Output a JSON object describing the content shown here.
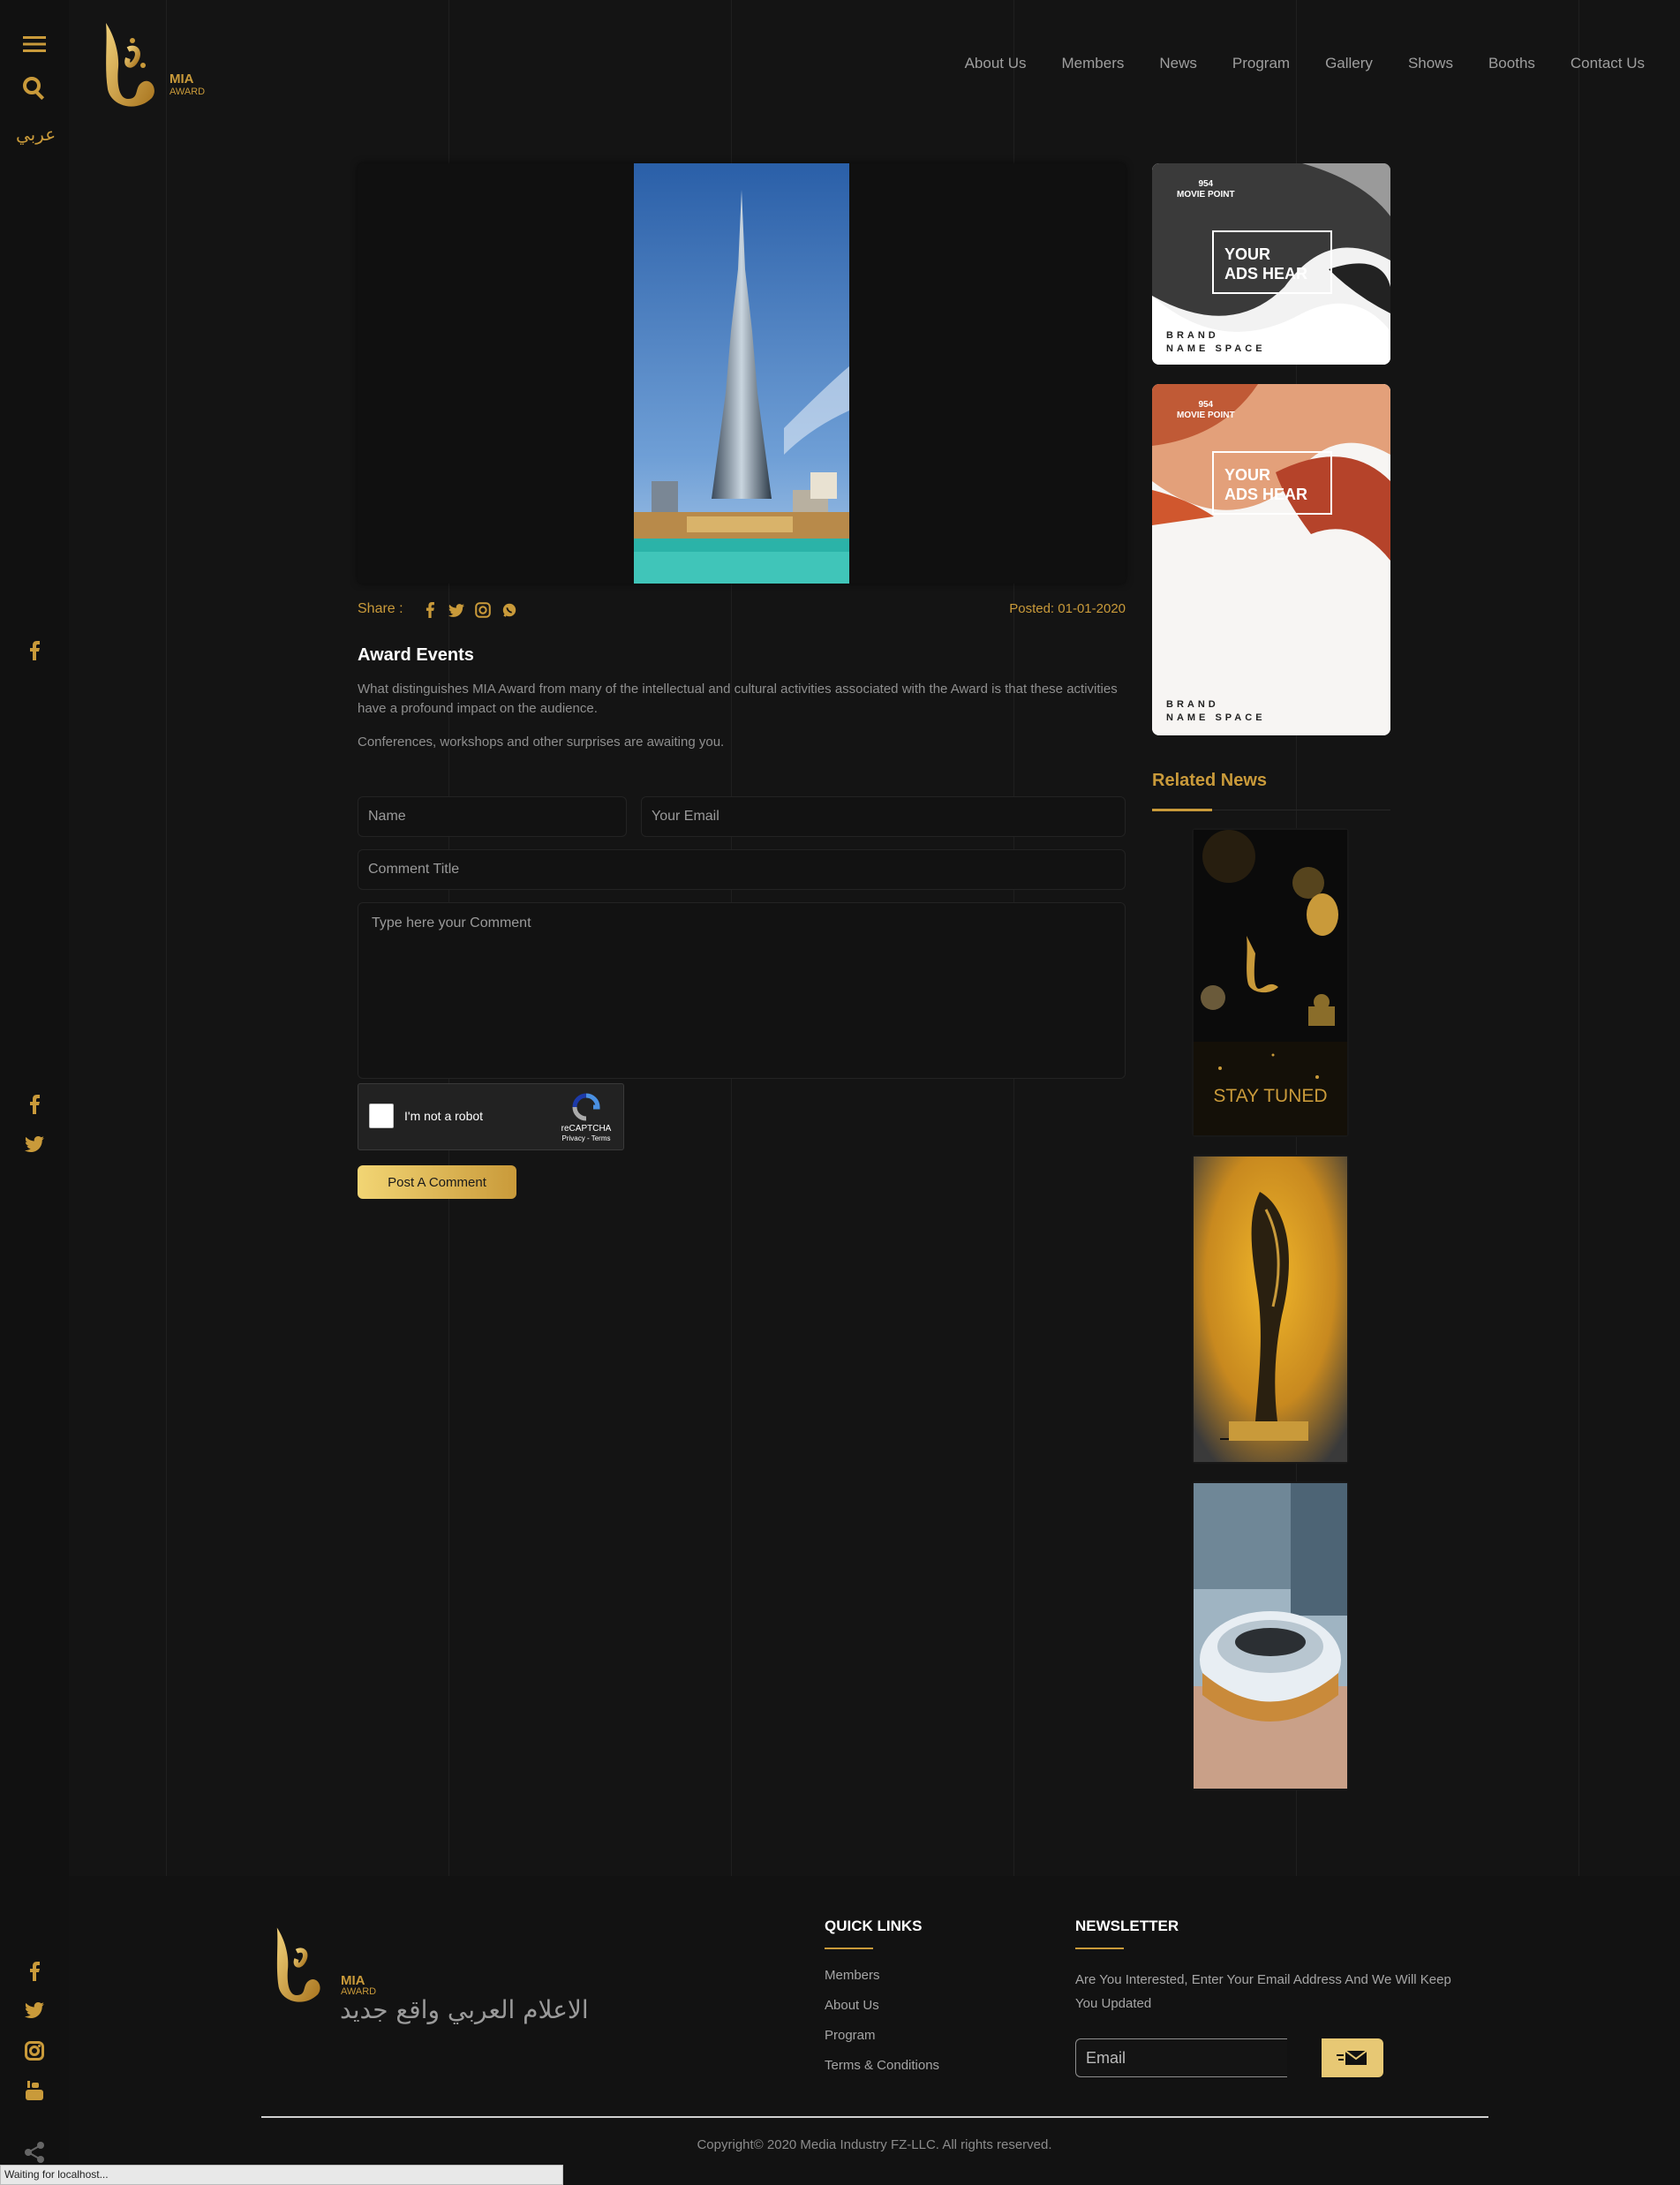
{
  "header": {
    "logo_text": "MIA",
    "logo_sub": "AWARD",
    "nav": [
      "About Us",
      "Members",
      "News",
      "Program",
      "Gallery",
      "Shows",
      "Booths",
      "Contact Us"
    ]
  },
  "rail": {
    "language_toggle": "عربي"
  },
  "article": {
    "share_label": "Share :",
    "posted": "Posted: 01-01-2020",
    "title": "Award Events",
    "paragraphs": [
      "What distinguishes MIA Award from many of the intellectual and cultural activities associated with the Award is that these activities have a profound impact on the audience.",
      "Conferences, workshops and other surprises are awaiting you."
    ]
  },
  "comment_form": {
    "name_placeholder": "Name",
    "email_placeholder": "Your Email",
    "title_placeholder": "Comment Title",
    "comment_placeholder": "Type here your Comment",
    "captcha_label": "I'm not a robot",
    "captcha_brand": "reCAPTCHA",
    "captcha_links": "Privacy - Terms",
    "submit_label": "Post A Comment"
  },
  "ads": [
    {
      "point": "954",
      "point_label": "MOVIE POINT",
      "headline_1": "YOUR",
      "headline_2": "ADS HEAR",
      "brand_1": "BRAND",
      "brand_2": "NAME SPACE",
      "accent": "#3a3a3a"
    },
    {
      "point": "954",
      "point_label": "MOVIE POINT",
      "headline_1": "YOUR",
      "headline_2": "ADS HEAR",
      "brand_1": "BRAND",
      "brand_2": "NAME SPACE",
      "accent": "#b5432a"
    }
  ],
  "related": {
    "title": "Related News",
    "thumb_1_caption": "STAY TUNED"
  },
  "footer": {
    "logo_text": "MIA",
    "logo_sub": "AWARD",
    "slogan": "الاعلام العربي واقع جديد",
    "quick_links_title": "QUICK LINKS",
    "quick_links": [
      "Members",
      "About Us",
      "Program",
      "Terms & Conditions"
    ],
    "newsletter_title": "NEWSLETTER",
    "newsletter_text": "Are You Interested, Enter Your Email Address And We Will Keep You Updated",
    "email_placeholder": "Email",
    "copyright": "Copyright© 2020 Media Industry FZ-LLC. All rights reserved."
  },
  "status_bar": "Waiting for localhost...",
  "colors": {
    "gold": "#c99a3a",
    "background": "#141414"
  }
}
